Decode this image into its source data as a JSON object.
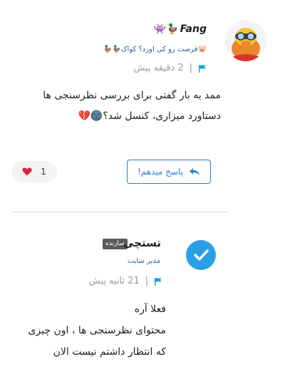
{
  "comment1": {
    "username": "Fang",
    "username_emojis": "👾🦆",
    "subtitle": "🐷فرصت رو کی اورد؟ کواک🦆🦆",
    "time": "2 دقیقه پیش",
    "separator": "|",
    "line1": "ممد یه بار گفتی برای بررسی نظرسنجی ها",
    "line2": "دستاورد میزاری، کنسل شد؟🌚💔",
    "reply_label": "پاسخ میدهم!",
    "like_count": "1"
  },
  "comment2": {
    "username": "تستچی",
    "badge": "سازنده",
    "role": "مدیر سایت",
    "time": "21 ثانیه پیش",
    "separator": "|",
    "line1": "فعلا آره",
    "line2": "محتوای نظرسنجی ها ، اون چیزی",
    "line3": "که انتظار داشتم نیست الان"
  },
  "colors": {
    "accent": "#2e7dd1",
    "verified": "#2b9fe6",
    "flag": "#1fa3e0",
    "heart": "#e0223a"
  },
  "icons": {
    "flag": "flag-icon",
    "reply": "reply-arrow-icon",
    "like": "heart-icon",
    "verified": "verified-check-icon"
  }
}
